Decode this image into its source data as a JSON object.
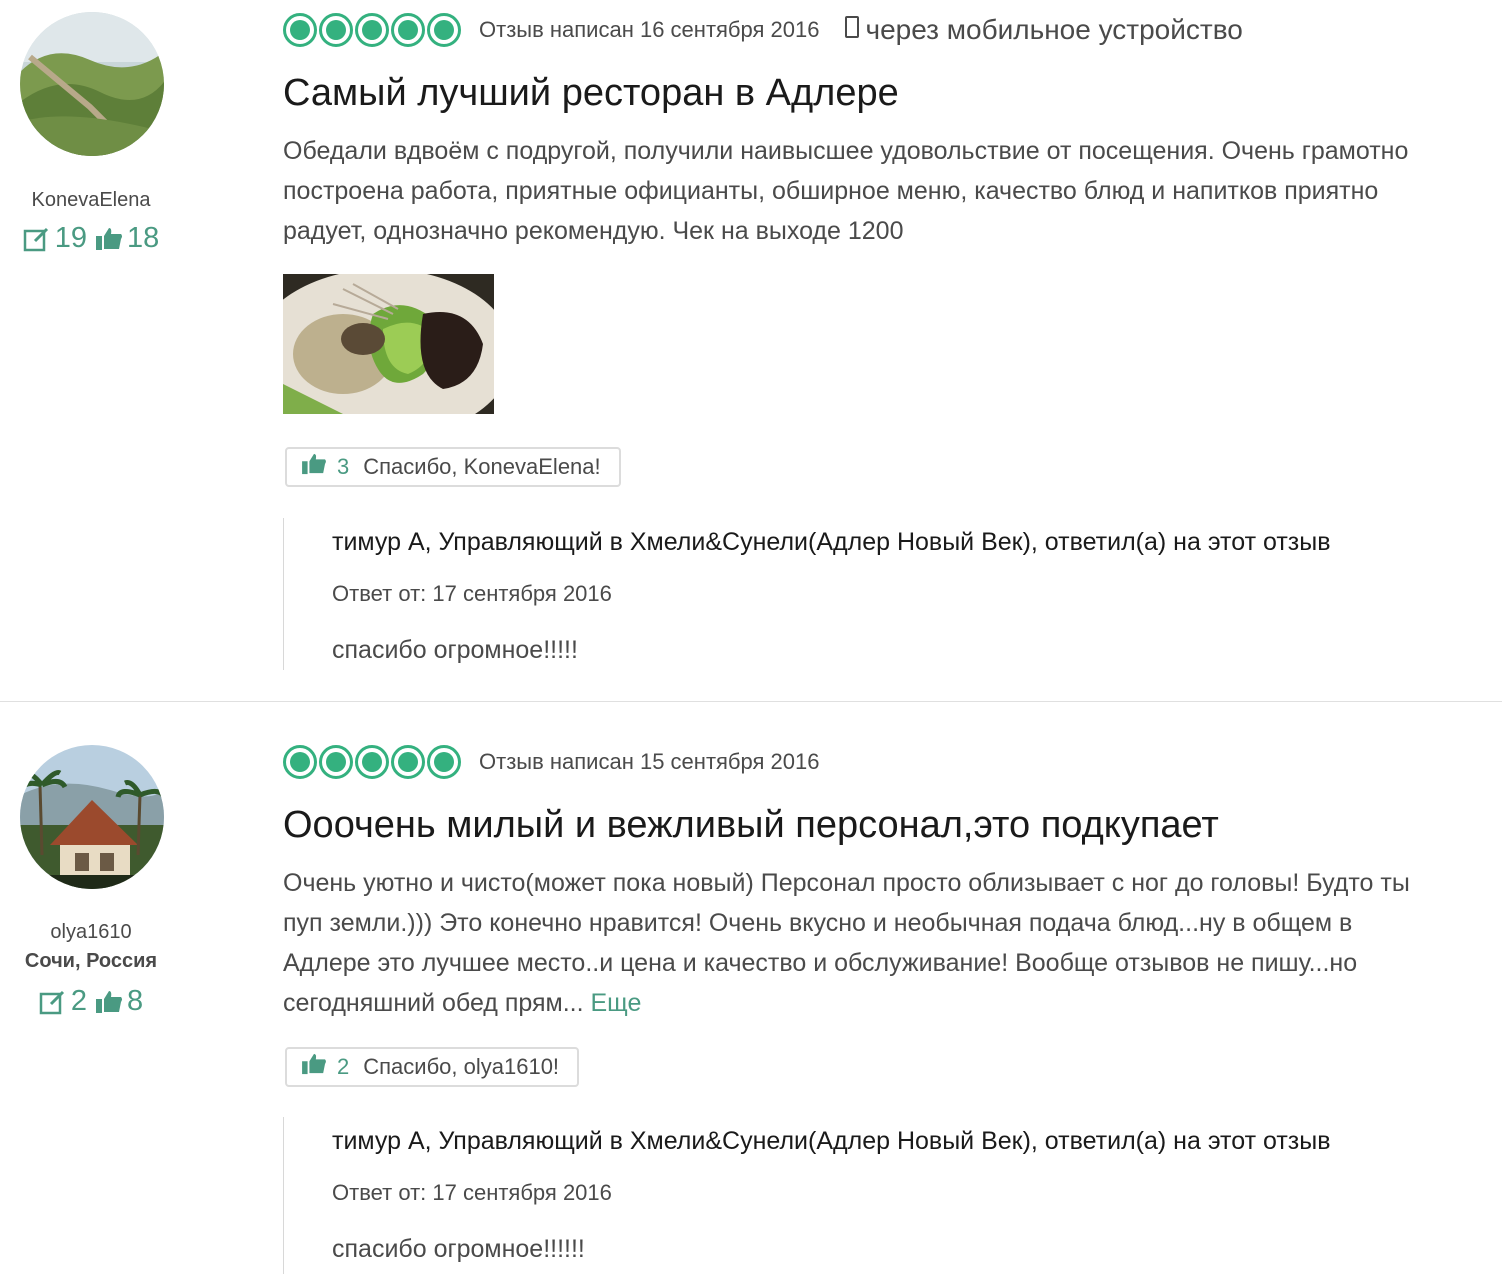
{
  "reviews": [
    {
      "user": {
        "name": "KonevaElena",
        "location": "",
        "reviews_count": "19",
        "helpful_count": "18"
      },
      "rating": 5,
      "date": "Отзыв написан 16 сентября 2016",
      "mobile": "через мобильное устройство",
      "title": "Самый лучший ресторан в Адлере",
      "text": "Обедали вдвоём с подругой, получили наивысшее удовольствие от посещения. Очень грамотно построена работа, приятные официанты, обширное меню, качество блюд и напитков приятно радует, однозначно рекомендую. Чек на выходе 1200",
      "more": "",
      "thanks": {
        "count": "3",
        "label": "Спасибо, KonevaElena!"
      },
      "response": {
        "author": "тимур А, Управляющий в Хмели&Сунели(Адлер Новый Век), ответил(а) на этот отзыв",
        "date": "Ответ от: 17 сентября 2016",
        "text": "спасибо огромное!!!!!"
      }
    },
    {
      "user": {
        "name": "olya1610",
        "location": "Сочи, Россия",
        "reviews_count": "2",
        "helpful_count": "8"
      },
      "rating": 5,
      "date": "Отзыв написан 15 сентября 2016",
      "mobile": "",
      "title": "Ооочень милый и вежливый персонал,это подкупает",
      "text": "Очень уютно и чисто(может пока новый) Персонал просто облизывает с ног до головы! Будто ты пуп земли.))) Это конечно нравится! Очень вкусно и необычная подача блюд...ну в общем в Адлере это лучшее место..и цена и качество и обслуживание! Вообще отзывов не пишу...но сегодняшний обед прям... ",
      "more": "Еще",
      "thanks": {
        "count": "2",
        "label": "Спасибо, olya1610!"
      },
      "response": {
        "author": "тимур А, Управляющий в Хмели&Сунели(Адлер Новый Век), ответил(а) на этот отзыв",
        "date": "Ответ от: 17 сентября 2016",
        "text": "спасибо огромное!!!!!!"
      }
    }
  ],
  "colors": {
    "accent": "#34b17f",
    "stat_green": "#4a9a82",
    "text": "#4a4a4a",
    "title": "#1a1a1a"
  },
  "icons": {
    "review_count": "edit-icon",
    "helpful": "thumbs-up-icon",
    "mobile": "phone-icon"
  }
}
